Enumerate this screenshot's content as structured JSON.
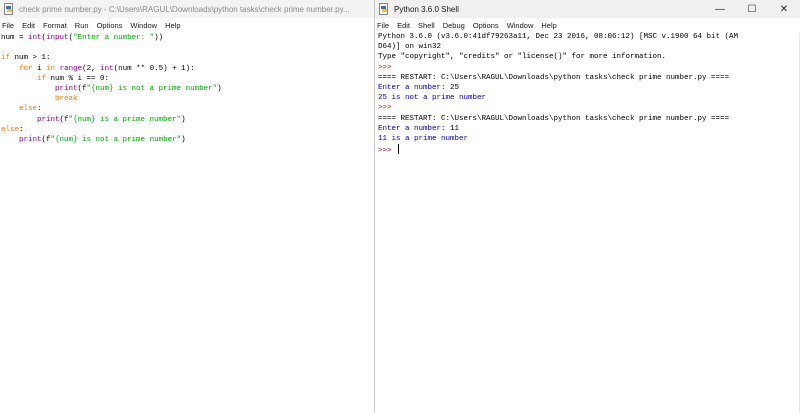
{
  "editor": {
    "title": "check prime number.py - C:\\Users\\RAGUL\\Downloads\\python tasks\\check prime number.py...",
    "menu": [
      "File",
      "Edit",
      "Format",
      "Run",
      "Options",
      "Window",
      "Help"
    ],
    "lines": [
      [
        {
          "t": "num = ",
          "c": "def"
        },
        {
          "t": "int",
          "c": "bi"
        },
        {
          "t": "(",
          "c": "def"
        },
        {
          "t": "input",
          "c": "bi"
        },
        {
          "t": "(",
          "c": "def"
        },
        {
          "t": "\"Enter a number: \"",
          "c": "str"
        },
        {
          "t": "))",
          "c": "def"
        }
      ],
      [],
      [
        {
          "t": "if",
          "c": "kw"
        },
        {
          "t": " num > 1:",
          "c": "def"
        }
      ],
      [
        {
          "t": "    ",
          "c": "def"
        },
        {
          "t": "for",
          "c": "kw"
        },
        {
          "t": " i ",
          "c": "def"
        },
        {
          "t": "in",
          "c": "kw"
        },
        {
          "t": " ",
          "c": "def"
        },
        {
          "t": "range",
          "c": "bi"
        },
        {
          "t": "(2, ",
          "c": "def"
        },
        {
          "t": "int",
          "c": "bi"
        },
        {
          "t": "(num ** 0.5) + 1):",
          "c": "def"
        }
      ],
      [
        {
          "t": "        ",
          "c": "def"
        },
        {
          "t": "if",
          "c": "kw"
        },
        {
          "t": " num % i == 0:",
          "c": "def"
        }
      ],
      [
        {
          "t": "            ",
          "c": "def"
        },
        {
          "t": "print",
          "c": "bi"
        },
        {
          "t": "(f",
          "c": "def"
        },
        {
          "t": "\"{num} is not a prime number\"",
          "c": "str"
        },
        {
          "t": ")",
          "c": "def"
        }
      ],
      [
        {
          "t": "            ",
          "c": "def"
        },
        {
          "t": "break",
          "c": "kw"
        }
      ],
      [
        {
          "t": "    ",
          "c": "def"
        },
        {
          "t": "else",
          "c": "kw"
        },
        {
          "t": ":",
          "c": "def"
        }
      ],
      [
        {
          "t": "        ",
          "c": "def"
        },
        {
          "t": "print",
          "c": "bi"
        },
        {
          "t": "(f",
          "c": "def"
        },
        {
          "t": "\"{num} is a prime number\"",
          "c": "str"
        },
        {
          "t": ")",
          "c": "def"
        }
      ],
      [
        {
          "t": "else",
          "c": "kw"
        },
        {
          "t": ":",
          "c": "def"
        }
      ],
      [
        {
          "t": "    ",
          "c": "def"
        },
        {
          "t": "print",
          "c": "bi"
        },
        {
          "t": "(f",
          "c": "def"
        },
        {
          "t": "\"{num} is not a prime number\"",
          "c": "str"
        },
        {
          "t": ")",
          "c": "def"
        }
      ]
    ]
  },
  "shell": {
    "title": "Python 3.6.0 Shell",
    "controls": {
      "minimize": "—",
      "maximize": "☐",
      "close": "✕"
    },
    "menu": [
      "File",
      "Edit",
      "Shell",
      "Debug",
      "Options",
      "Window",
      "Help"
    ],
    "lines": [
      [
        {
          "t": "Python 3.6.0 (v3.6.0:41df79263a11, Dec 23 2016, 08:06:12) [MSC v.1900 64 bit (AM",
          "c": "def"
        }
      ],
      [
        {
          "t": "D64)] on win32",
          "c": "def"
        }
      ],
      [
        {
          "t": "Type \"copyright\", \"credits\" or \"license()\" for more information.",
          "c": "def"
        }
      ],
      [
        {
          "t": ">>> ",
          "c": "prompt"
        }
      ],
      [
        {
          "t": "==== RESTART: C:\\Users\\RAGUL\\Downloads\\python tasks\\check prime number.py ====",
          "c": "def"
        }
      ],
      [
        {
          "t": "Enter a number: ",
          "c": "out"
        },
        {
          "t": "25",
          "c": "in"
        }
      ],
      [
        {
          "t": "25 is not a prime number",
          "c": "out"
        }
      ],
      [
        {
          "t": ">>> ",
          "c": "prompt"
        }
      ],
      [
        {
          "t": "==== RESTART: C:\\Users\\RAGUL\\Downloads\\python tasks\\check prime number.py ====",
          "c": "def"
        }
      ],
      [
        {
          "t": "Enter a number: ",
          "c": "out"
        },
        {
          "t": "11",
          "c": "in"
        }
      ],
      [
        {
          "t": "11 is a prime number",
          "c": "out"
        }
      ],
      [
        {
          "t": ">>> ",
          "c": "prompt"
        }
      ]
    ]
  }
}
